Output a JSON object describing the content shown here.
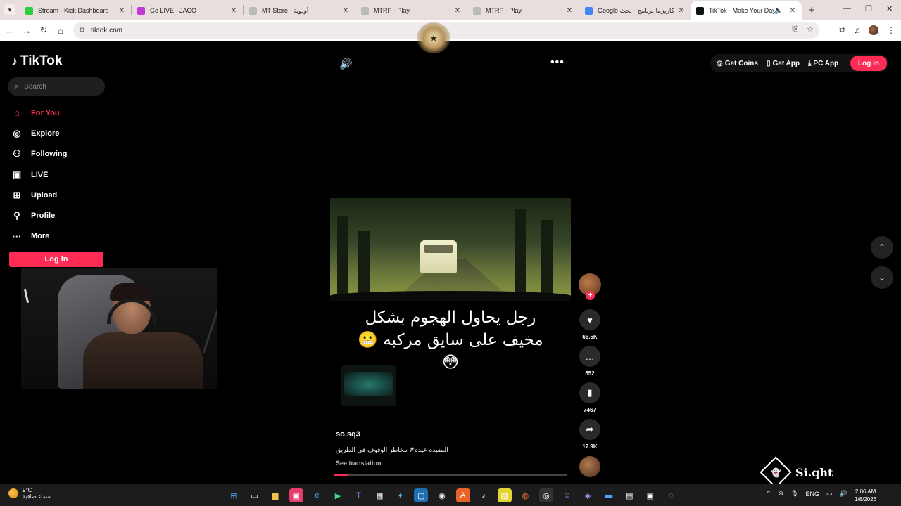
{
  "browser": {
    "tabs": [
      {
        "title": "Stream - Kick Dashboard",
        "fav_color": "#2ecc40"
      },
      {
        "title": "Go LIVE - JACO",
        "fav_color": "#c23bd4"
      },
      {
        "title": "MT Store - أولوية",
        "fav_color": "#bbbbbb"
      },
      {
        "title": "MTRP - Play",
        "fav_color": "#bbbbbb"
      },
      {
        "title": "MTRP - Play",
        "fav_color": "#bbbbbb"
      },
      {
        "title": "Google كاريزما برنامج - بحث",
        "fav_color": "#4285f4"
      },
      {
        "title": "TikTok - Make Your Day",
        "fav_color": "#111111"
      }
    ],
    "url": "tiktok.com"
  },
  "sidebar": {
    "logo": "TikTok",
    "search_placeholder": "Search",
    "nav": [
      {
        "label": "For You",
        "icon": "home-icon",
        "active": true
      },
      {
        "label": "Explore",
        "icon": "compass-icon",
        "active": false
      },
      {
        "label": "Following",
        "icon": "following-icon",
        "active": false
      },
      {
        "label": "LIVE",
        "icon": "live-icon",
        "active": false
      },
      {
        "label": "Upload",
        "icon": "upload-icon",
        "active": false
      },
      {
        "label": "Profile",
        "icon": "profile-icon",
        "active": false
      },
      {
        "label": "More",
        "icon": "more-icon",
        "active": false
      }
    ],
    "login": "Log in"
  },
  "header": {
    "get_coins": "Get Coins",
    "get_app": "Get App",
    "pc_app": "PC App",
    "login": "Log in"
  },
  "video": {
    "caption_line1": "رجل يحاول الهجوم بشكل",
    "caption_line2": "مخيف على سايق مركبه 😬",
    "caption_line3": "😳",
    "author": "so.sq3",
    "description": "المفيده عيده# مخاطر الوقوف في الطريق",
    "see_translation": "See translation",
    "progress": 0.06
  },
  "actions": {
    "likes": "66.5K",
    "comments": "552",
    "saves": "7467",
    "shares": "17.9K"
  },
  "overlay": {
    "brand": "Si.qht"
  },
  "taskbar": {
    "temp": "9°C",
    "condition": "سماء صافية",
    "lang": "ENG",
    "time": "2:06 AM",
    "date": "1/8/2026"
  },
  "colors": {
    "accent": "#fe2c55",
    "background": "#000000"
  }
}
